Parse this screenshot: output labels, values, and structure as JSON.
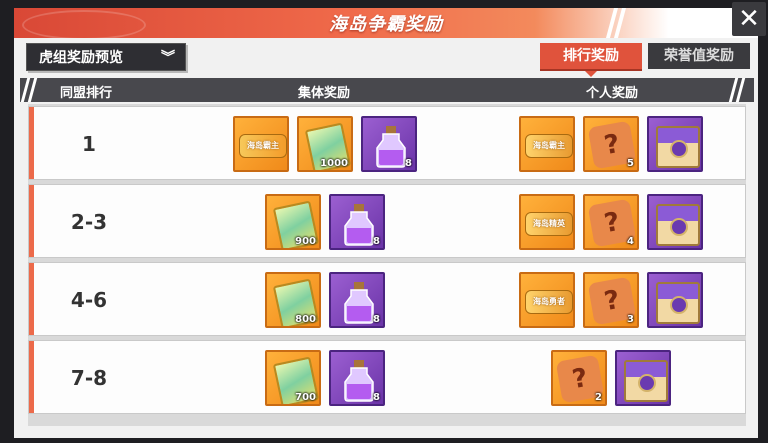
{
  "header": {
    "title": "海岛争霸奖励",
    "close_icon": "close-icon"
  },
  "controls": {
    "group_select": "虎组奖励预览",
    "tabs": [
      {
        "label": "排行奖励",
        "active": true
      },
      {
        "label": "荣誉值奖励",
        "active": false
      }
    ]
  },
  "columns": {
    "rank": "同盟排行",
    "collective": "集体奖励",
    "personal": "个人奖励"
  },
  "rows": [
    {
      "rank": "1",
      "collective": [
        {
          "icon": "title-card-icon",
          "label": "海岛霸主",
          "qty": ""
        },
        {
          "icon": "ticket-icon",
          "qty": "1000"
        },
        {
          "icon": "potion-bottle-icon",
          "qty": "8"
        }
      ],
      "personal": [
        {
          "icon": "title-banner-icon",
          "label": "海岛霸主",
          "qty": ""
        },
        {
          "icon": "mystery-puzzle-icon",
          "qty": "5"
        },
        {
          "icon": "treasure-chest-icon",
          "qty": ""
        }
      ]
    },
    {
      "rank": "2-3",
      "collective": [
        {
          "icon": "ticket-icon",
          "qty": "900"
        },
        {
          "icon": "potion-bottle-icon",
          "qty": "8"
        }
      ],
      "personal": [
        {
          "icon": "title-banner-icon",
          "label": "海岛精英",
          "qty": ""
        },
        {
          "icon": "mystery-puzzle-icon",
          "qty": "4"
        },
        {
          "icon": "treasure-chest-icon",
          "qty": ""
        }
      ]
    },
    {
      "rank": "4-6",
      "collective": [
        {
          "icon": "ticket-icon",
          "qty": "800"
        },
        {
          "icon": "potion-bottle-icon",
          "qty": "8"
        }
      ],
      "personal": [
        {
          "icon": "title-banner-icon",
          "label": "海岛勇者",
          "qty": ""
        },
        {
          "icon": "mystery-puzzle-icon",
          "qty": "3"
        },
        {
          "icon": "treasure-chest-icon",
          "qty": ""
        }
      ]
    },
    {
      "rank": "7-8",
      "collective": [
        {
          "icon": "ticket-icon",
          "qty": "700"
        },
        {
          "icon": "potion-bottle-icon",
          "qty": "8"
        }
      ],
      "personal": [
        {
          "icon": "mystery-puzzle-icon",
          "qty": "2"
        },
        {
          "icon": "treasure-chest-icon",
          "qty": ""
        }
      ]
    }
  ]
}
